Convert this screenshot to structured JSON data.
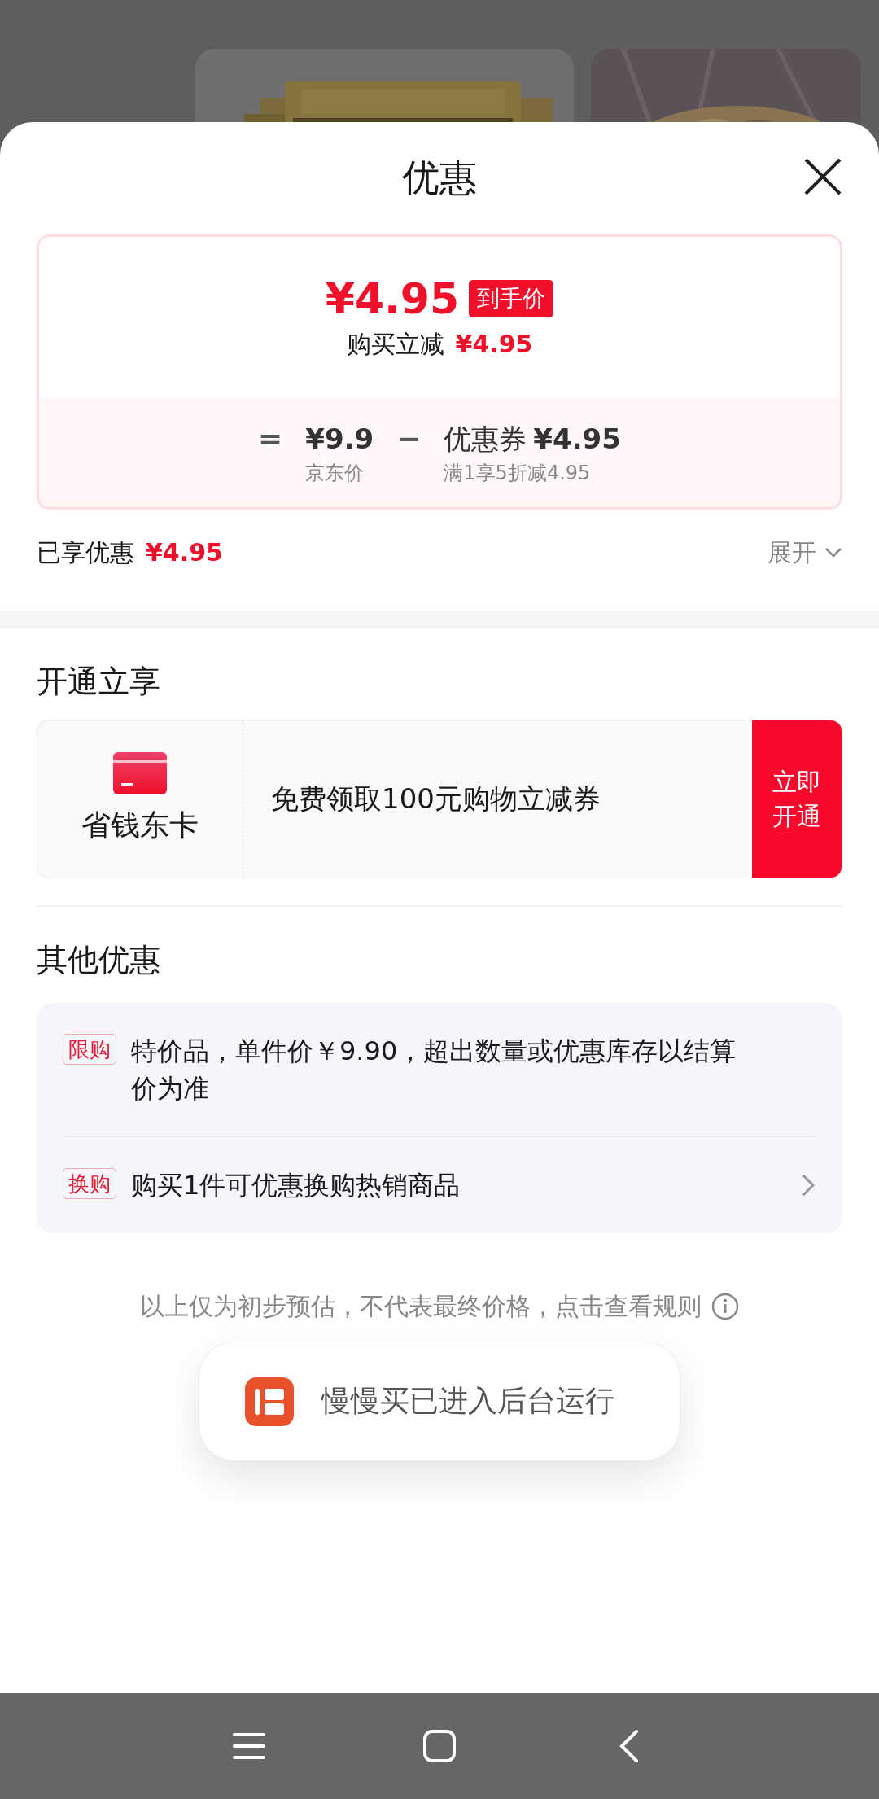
{
  "sheet": {
    "title": "优惠"
  },
  "price_card": {
    "final_price": "¥4.95",
    "final_badge": "到手价",
    "reduction_label": "购买立减",
    "reduction_amount": "¥4.95",
    "equation": [
      {
        "kind": "operator",
        "symbol": "="
      },
      {
        "kind": "term",
        "value": "¥9.9",
        "caption": "京东价"
      },
      {
        "kind": "operator",
        "symbol": "−"
      },
      {
        "kind": "term",
        "label": "优惠券",
        "value": "¥4.95",
        "caption": "满1享5折减4.95"
      }
    ]
  },
  "enjoyed": {
    "label": "已享优惠",
    "amount": "¥4.95",
    "expand_label": "展开"
  },
  "membership": {
    "heading": "开通立享",
    "card_name": "省钱东卡",
    "offer": "免费领取100元购物立减券",
    "button": "立即开通"
  },
  "other": {
    "heading": "其他优惠",
    "items": [
      {
        "tag": "限购",
        "text": "特价品，单件价￥9.90，超出数量或优惠库存以结算价为准",
        "has_arrow": false
      },
      {
        "tag": "换购",
        "text": "购买1件可优惠换购热销商品",
        "has_arrow": true
      }
    ]
  },
  "disclaimer": "以上仅为初步预估，不代表最终价格，点击查看规则",
  "toast": {
    "text": "慢慢买已进入后台运行"
  }
}
